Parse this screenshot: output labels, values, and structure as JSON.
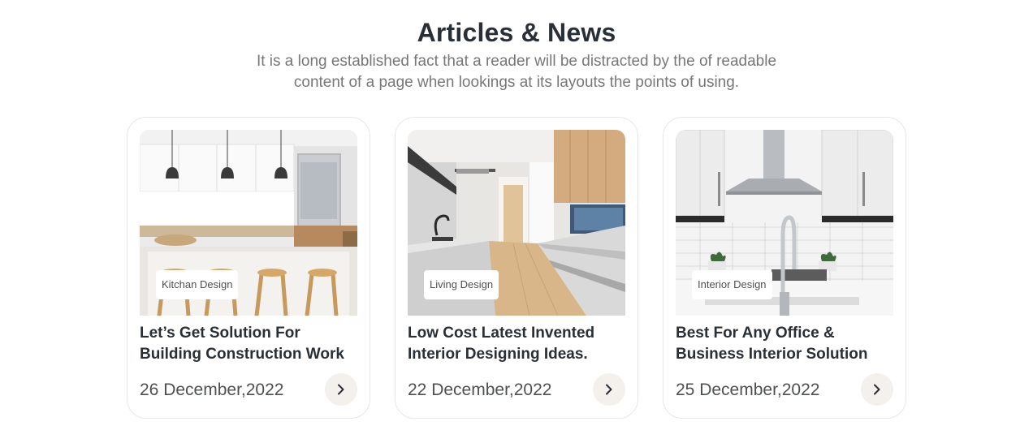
{
  "section": {
    "title": "Articles & News",
    "subtitle": "It is a long established fact that a reader will be distracted by the of readable content of a page when lookings at its layouts the points of using."
  },
  "articles": [
    {
      "tag": "Kitchan Design",
      "title": "Let’s Get Solution For Building Construction Work",
      "date": "26 December,2022",
      "arrow_icon": "chevron-right-icon"
    },
    {
      "tag": "Living Design",
      "title": "Low Cost Latest Invented Interior Designing Ideas.",
      "date": "22 December,2022",
      "arrow_icon": "chevron-right-icon"
    },
    {
      "tag": "Interior Design",
      "title": "Best For Any Office & Business Interior Solution",
      "date": "25 December,2022",
      "arrow_icon": "chevron-right-icon"
    }
  ],
  "colors": {
    "heading": "#292f36",
    "text": "#4d5053",
    "muted": "#777777",
    "arrow_bg": "#f4f0ec",
    "border": "#e7e7e7"
  }
}
